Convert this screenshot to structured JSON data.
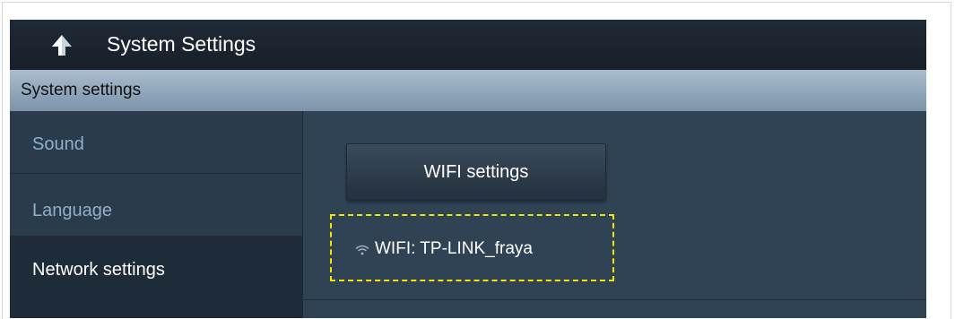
{
  "header": {
    "title": "System Settings",
    "back_icon": "back-arrow-icon"
  },
  "section": {
    "label": "System settings"
  },
  "sidebar": {
    "items": [
      {
        "label": "Sound",
        "selected": false
      },
      {
        "label": "Language",
        "selected": false
      },
      {
        "label": "Network settings",
        "selected": true
      }
    ]
  },
  "main": {
    "wifi_button_label": "WIFI settings",
    "wifi_status": "WIFI: TP-LINK_fraya",
    "wifi_icon": "wifi-icon"
  },
  "colors": {
    "titlebar": "#1c2530",
    "section_bar": "#8fa6ba",
    "panel": "#2d3f50",
    "highlight_dashed": "#f5e400",
    "inactive_text": "#8fb0c9"
  }
}
